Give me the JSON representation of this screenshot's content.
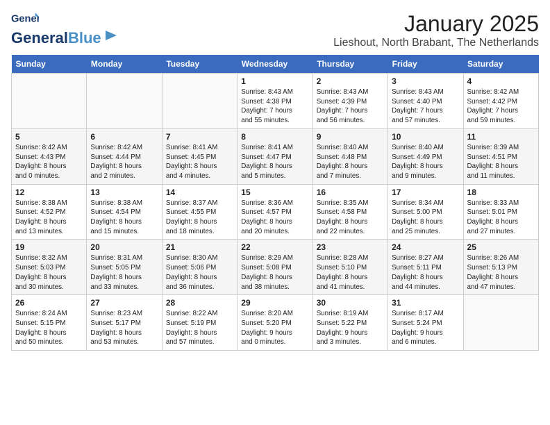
{
  "logo": {
    "line1": "General",
    "line2": "Blue"
  },
  "title": "January 2025",
  "subtitle": "Lieshout, North Brabant, The Netherlands",
  "days_of_week": [
    "Sunday",
    "Monday",
    "Tuesday",
    "Wednesday",
    "Thursday",
    "Friday",
    "Saturday"
  ],
  "weeks": [
    [
      {
        "day": "",
        "info": ""
      },
      {
        "day": "",
        "info": ""
      },
      {
        "day": "",
        "info": ""
      },
      {
        "day": "1",
        "info": "Sunrise: 8:43 AM\nSunset: 4:38 PM\nDaylight: 7 hours\nand 55 minutes."
      },
      {
        "day": "2",
        "info": "Sunrise: 8:43 AM\nSunset: 4:39 PM\nDaylight: 7 hours\nand 56 minutes."
      },
      {
        "day": "3",
        "info": "Sunrise: 8:43 AM\nSunset: 4:40 PM\nDaylight: 7 hours\nand 57 minutes."
      },
      {
        "day": "4",
        "info": "Sunrise: 8:42 AM\nSunset: 4:42 PM\nDaylight: 7 hours\nand 59 minutes."
      }
    ],
    [
      {
        "day": "5",
        "info": "Sunrise: 8:42 AM\nSunset: 4:43 PM\nDaylight: 8 hours\nand 0 minutes."
      },
      {
        "day": "6",
        "info": "Sunrise: 8:42 AM\nSunset: 4:44 PM\nDaylight: 8 hours\nand 2 minutes."
      },
      {
        "day": "7",
        "info": "Sunrise: 8:41 AM\nSunset: 4:45 PM\nDaylight: 8 hours\nand 4 minutes."
      },
      {
        "day": "8",
        "info": "Sunrise: 8:41 AM\nSunset: 4:47 PM\nDaylight: 8 hours\nand 5 minutes."
      },
      {
        "day": "9",
        "info": "Sunrise: 8:40 AM\nSunset: 4:48 PM\nDaylight: 8 hours\nand 7 minutes."
      },
      {
        "day": "10",
        "info": "Sunrise: 8:40 AM\nSunset: 4:49 PM\nDaylight: 8 hours\nand 9 minutes."
      },
      {
        "day": "11",
        "info": "Sunrise: 8:39 AM\nSunset: 4:51 PM\nDaylight: 8 hours\nand 11 minutes."
      }
    ],
    [
      {
        "day": "12",
        "info": "Sunrise: 8:38 AM\nSunset: 4:52 PM\nDaylight: 8 hours\nand 13 minutes."
      },
      {
        "day": "13",
        "info": "Sunrise: 8:38 AM\nSunset: 4:54 PM\nDaylight: 8 hours\nand 15 minutes."
      },
      {
        "day": "14",
        "info": "Sunrise: 8:37 AM\nSunset: 4:55 PM\nDaylight: 8 hours\nand 18 minutes."
      },
      {
        "day": "15",
        "info": "Sunrise: 8:36 AM\nSunset: 4:57 PM\nDaylight: 8 hours\nand 20 minutes."
      },
      {
        "day": "16",
        "info": "Sunrise: 8:35 AM\nSunset: 4:58 PM\nDaylight: 8 hours\nand 22 minutes."
      },
      {
        "day": "17",
        "info": "Sunrise: 8:34 AM\nSunset: 5:00 PM\nDaylight: 8 hours\nand 25 minutes."
      },
      {
        "day": "18",
        "info": "Sunrise: 8:33 AM\nSunset: 5:01 PM\nDaylight: 8 hours\nand 27 minutes."
      }
    ],
    [
      {
        "day": "19",
        "info": "Sunrise: 8:32 AM\nSunset: 5:03 PM\nDaylight: 8 hours\nand 30 minutes."
      },
      {
        "day": "20",
        "info": "Sunrise: 8:31 AM\nSunset: 5:05 PM\nDaylight: 8 hours\nand 33 minutes."
      },
      {
        "day": "21",
        "info": "Sunrise: 8:30 AM\nSunset: 5:06 PM\nDaylight: 8 hours\nand 36 minutes."
      },
      {
        "day": "22",
        "info": "Sunrise: 8:29 AM\nSunset: 5:08 PM\nDaylight: 8 hours\nand 38 minutes."
      },
      {
        "day": "23",
        "info": "Sunrise: 8:28 AM\nSunset: 5:10 PM\nDaylight: 8 hours\nand 41 minutes."
      },
      {
        "day": "24",
        "info": "Sunrise: 8:27 AM\nSunset: 5:11 PM\nDaylight: 8 hours\nand 44 minutes."
      },
      {
        "day": "25",
        "info": "Sunrise: 8:26 AM\nSunset: 5:13 PM\nDaylight: 8 hours\nand 47 minutes."
      }
    ],
    [
      {
        "day": "26",
        "info": "Sunrise: 8:24 AM\nSunset: 5:15 PM\nDaylight: 8 hours\nand 50 minutes."
      },
      {
        "day": "27",
        "info": "Sunrise: 8:23 AM\nSunset: 5:17 PM\nDaylight: 8 hours\nand 53 minutes."
      },
      {
        "day": "28",
        "info": "Sunrise: 8:22 AM\nSunset: 5:19 PM\nDaylight: 8 hours\nand 57 minutes."
      },
      {
        "day": "29",
        "info": "Sunrise: 8:20 AM\nSunset: 5:20 PM\nDaylight: 9 hours\nand 0 minutes."
      },
      {
        "day": "30",
        "info": "Sunrise: 8:19 AM\nSunset: 5:22 PM\nDaylight: 9 hours\nand 3 minutes."
      },
      {
        "day": "31",
        "info": "Sunrise: 8:17 AM\nSunset: 5:24 PM\nDaylight: 9 hours\nand 6 minutes."
      },
      {
        "day": "",
        "info": ""
      }
    ]
  ]
}
